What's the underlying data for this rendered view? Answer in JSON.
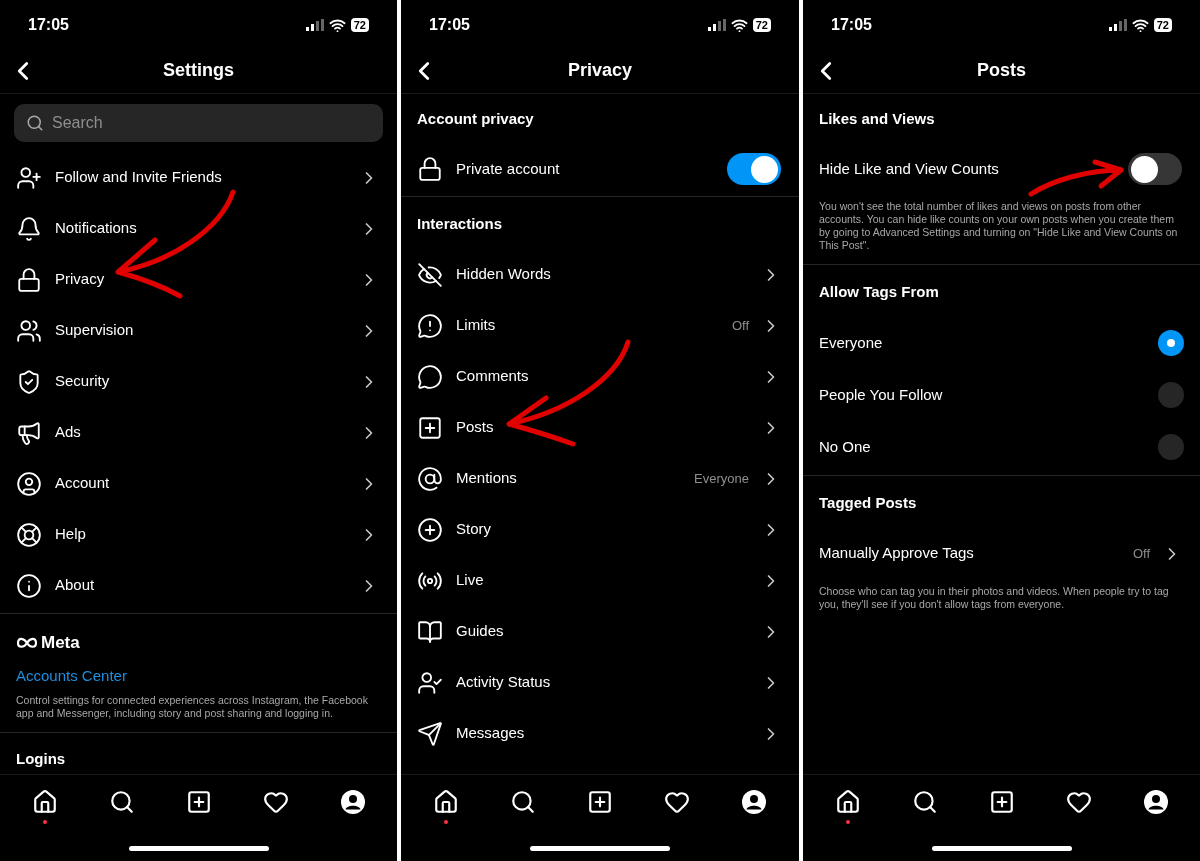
{
  "panels": [
    {
      "time": "17:05",
      "battery": "72",
      "title": "Settings",
      "items": [
        {
          "kind": "search",
          "placeholder": "Search"
        },
        {
          "kind": "link",
          "label": "Follow and Invite Friends"
        },
        {
          "kind": "link",
          "label": "Notifications"
        },
        {
          "kind": "link",
          "label": "Privacy"
        },
        {
          "kind": "link",
          "label": "Supervision"
        },
        {
          "kind": "link",
          "label": "Security"
        },
        {
          "kind": "link",
          "label": "Ads"
        },
        {
          "kind": "link",
          "label": "Account"
        },
        {
          "kind": "link",
          "label": "Help"
        },
        {
          "kind": "link",
          "label": "About"
        },
        {
          "kind": "divider"
        },
        {
          "kind": "brand",
          "label": "Meta"
        },
        {
          "kind": "textlink",
          "label": "Accounts Center"
        },
        {
          "kind": "note",
          "text": "Control settings for connected experiences across Instagram, the Facebook app and Messenger, including story and post sharing and logging in."
        },
        {
          "kind": "divider"
        },
        {
          "kind": "section",
          "label": "Logins"
        }
      ],
      "nav": [
        {
          "dot": true
        },
        {
          "dot": false
        },
        {
          "dot": false
        },
        {
          "dot": false
        },
        {
          "dot": false
        }
      ]
    },
    {
      "time": "17:05",
      "battery": "72",
      "title": "Privacy",
      "items": [
        {
          "kind": "section",
          "label": "Account privacy"
        },
        {
          "kind": "toggle",
          "label": "Private account",
          "on": true
        },
        {
          "kind": "divider"
        },
        {
          "kind": "section",
          "label": "Interactions"
        },
        {
          "kind": "link",
          "label": "Hidden Words"
        },
        {
          "kind": "link",
          "label": "Limits",
          "value": "Off"
        },
        {
          "kind": "link",
          "label": "Comments"
        },
        {
          "kind": "link",
          "label": "Posts"
        },
        {
          "kind": "link",
          "label": "Mentions",
          "value": "Everyone"
        },
        {
          "kind": "link",
          "label": "Story"
        },
        {
          "kind": "link",
          "label": "Live"
        },
        {
          "kind": "link",
          "label": "Guides"
        },
        {
          "kind": "link",
          "label": "Activity Status"
        },
        {
          "kind": "link",
          "label": "Messages"
        }
      ],
      "nav": [
        {
          "dot": true
        },
        {
          "dot": false
        },
        {
          "dot": false
        },
        {
          "dot": false
        },
        {
          "dot": false
        }
      ]
    },
    {
      "time": "17:05",
      "battery": "72",
      "title": "Posts",
      "items": [
        {
          "kind": "section",
          "label": "Likes and Views"
        },
        {
          "kind": "toggle",
          "label": "Hide Like and View Counts",
          "on": false
        },
        {
          "kind": "note",
          "text": "You won't see the total number of likes and views on posts from other accounts. You can hide like counts on your own posts when you create them by going to Advanced Settings and turning on \"Hide Like and View Counts on This Post\"."
        },
        {
          "kind": "divider"
        },
        {
          "kind": "section",
          "label": "Allow Tags From"
        },
        {
          "kind": "radio",
          "label": "Everyone",
          "selected": true
        },
        {
          "kind": "radio",
          "label": "People You Follow",
          "selected": false
        },
        {
          "kind": "radio",
          "label": "No One",
          "selected": false
        },
        {
          "kind": "divider"
        },
        {
          "kind": "section",
          "label": "Tagged Posts"
        },
        {
          "kind": "link",
          "label": "Manually Approve Tags",
          "value": "Off"
        },
        {
          "kind": "note",
          "text": "Choose who can tag you in their photos and videos. When people try to tag you, they'll see if you don't allow tags from everyone."
        }
      ],
      "nav": [
        {
          "dot": true
        },
        {
          "dot": false
        },
        {
          "dot": false
        },
        {
          "dot": false
        },
        {
          "dot": false
        }
      ]
    }
  ]
}
